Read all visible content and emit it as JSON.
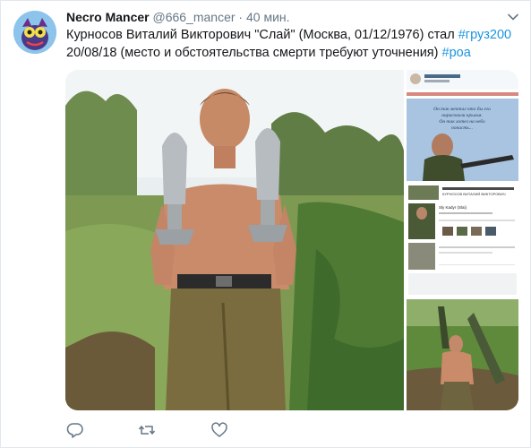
{
  "tweet": {
    "author_name": "Necro Mancer",
    "handle": "@666_mancer",
    "separator": "·",
    "time": "40 мин.",
    "text_line1": "Курносов Виталий Викторович \"Слай\" (Москва, 01/12/1976) стал ",
    "hashtag1": "#груз200",
    "text_line2": "20/08/18 (место и обстоятельства смерти требуют уточнения) ",
    "hashtag2": "#роа"
  },
  "media": {
    "thumb1_caption_line1": "Он так мечтал что бы его",
    "thumb1_caption_line2": "нарисовали крылья.",
    "thumb1_caption_line3": "Он так хотел на небо",
    "thumb1_caption_line4": "попасть...",
    "thumb2_profile_name": "Sly Kadyr (Slai)",
    "thumb2_profile_title": "КУРНОСОВ ВИТАЛИЙ ВИКТОРОВИЧ"
  },
  "actions": {
    "reply_icon": "reply-icon",
    "retweet_icon": "retweet-icon",
    "like_icon": "heart-icon"
  },
  "colors": {
    "text": "#14171a",
    "secondary": "#657786",
    "link": "#1b95e0",
    "border": "#e1e8ed"
  }
}
